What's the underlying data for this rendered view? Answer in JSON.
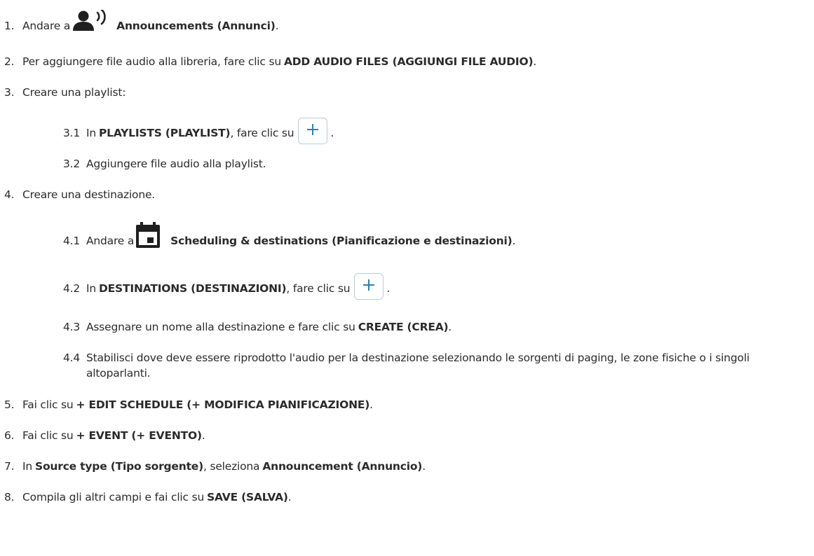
{
  "steps": [
    {
      "num": "1.",
      "a": "Andare a",
      "b": "Announcements (Annunci)",
      "c": "."
    },
    {
      "num": "2.",
      "a": "Per aggiungere file audio alla libreria, fare clic su",
      "b": "ADD AUDIO FILES (AGGIUNGI FILE AUDIO)",
      "c": "."
    },
    {
      "num": "3.",
      "a": "Creare una playlist:"
    },
    {
      "num": "4.",
      "a": "Creare una destinazione."
    },
    {
      "num": "5.",
      "a": "Fai clic su",
      "b": "+ EDIT SCHEDULE (+ MODIFICA PIANIFICAZIONE)",
      "c": "."
    },
    {
      "num": "6.",
      "a": "Fai clic su",
      "b": "+ EVENT (+ EVENTO)",
      "c": "."
    },
    {
      "num": "7.",
      "a": "In",
      "b": "Source type (Tipo sorgente)",
      "c": ", seleziona",
      "d": "Announcement (Annuncio)",
      "e": "."
    },
    {
      "num": "8.",
      "a": "Compila gli altri campi e fai clic su",
      "b": "SAVE (SALVA)",
      "c": "."
    }
  ],
  "sub3": [
    {
      "num": "3.1",
      "a": "In",
      "b": "PLAYLISTS (PLAYLIST)",
      "c": ", fare clic su",
      "d": "."
    },
    {
      "num": "3.2",
      "a": "Aggiungere file audio alla playlist."
    }
  ],
  "sub4": [
    {
      "num": "4.1",
      "a": "Andare a",
      "b": "Scheduling & destinations (Pianificazione e destinazioni)",
      "c": "."
    },
    {
      "num": "4.2",
      "a": "In",
      "b": "DESTINATIONS (DESTINAZIONI)",
      "c": ", fare clic su",
      "d": "."
    },
    {
      "num": "4.3",
      "a": "Assegnare un nome alla destinazione e fare clic su",
      "b": "CREATE (CREA)",
      "c": "."
    },
    {
      "num": "4.4",
      "a": "Stabilisci dove deve essere riprodotto l'audio per la destinazione selezionando le sorgenti di paging, le zone fisiche o i singoli altoparlanti."
    }
  ],
  "icons": {
    "announcements": "person-speaking-icon",
    "scheduling": "calendar-icon",
    "add": "plus-icon"
  },
  "colors": {
    "text": "#2b2b2b",
    "icon": "#1f1f1f",
    "plus": "#2f7fb5",
    "button_border": "#b9cdd8"
  }
}
